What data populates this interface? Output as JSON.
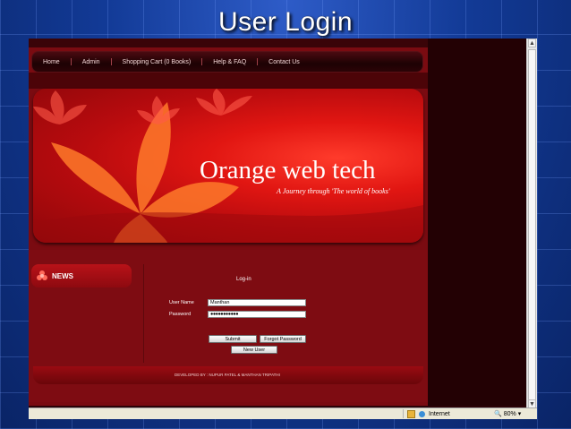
{
  "slide": {
    "title": "User Login"
  },
  "nav": {
    "items": [
      "Home",
      "Admin",
      "Shopping Cart (0 Books)",
      "Help & FAQ",
      "Contact Us"
    ]
  },
  "banner": {
    "title": "Orange web tech",
    "subtitle": "A Journey through 'The world of books'"
  },
  "sidebar": {
    "news_label": "NEWS"
  },
  "form": {
    "title": "Log-in",
    "username_label": "User Name",
    "username_value": "Manthan",
    "password_label": "Password",
    "password_value": "●●●●●●●●●●●",
    "submit_label": "Submit",
    "forgot_label": "Forgot Password",
    "newuser_label": "New User"
  },
  "footer": {
    "credit": "DEVELOPED BY : NUPUR PATEL & MANTHAN TRIPATHI"
  },
  "statusbar": {
    "zone": "Internet",
    "zoom": "80%"
  },
  "colors": {
    "page_red": "#7a0b11",
    "banner_red": "#e11612",
    "slide_blue": "#123a96"
  }
}
